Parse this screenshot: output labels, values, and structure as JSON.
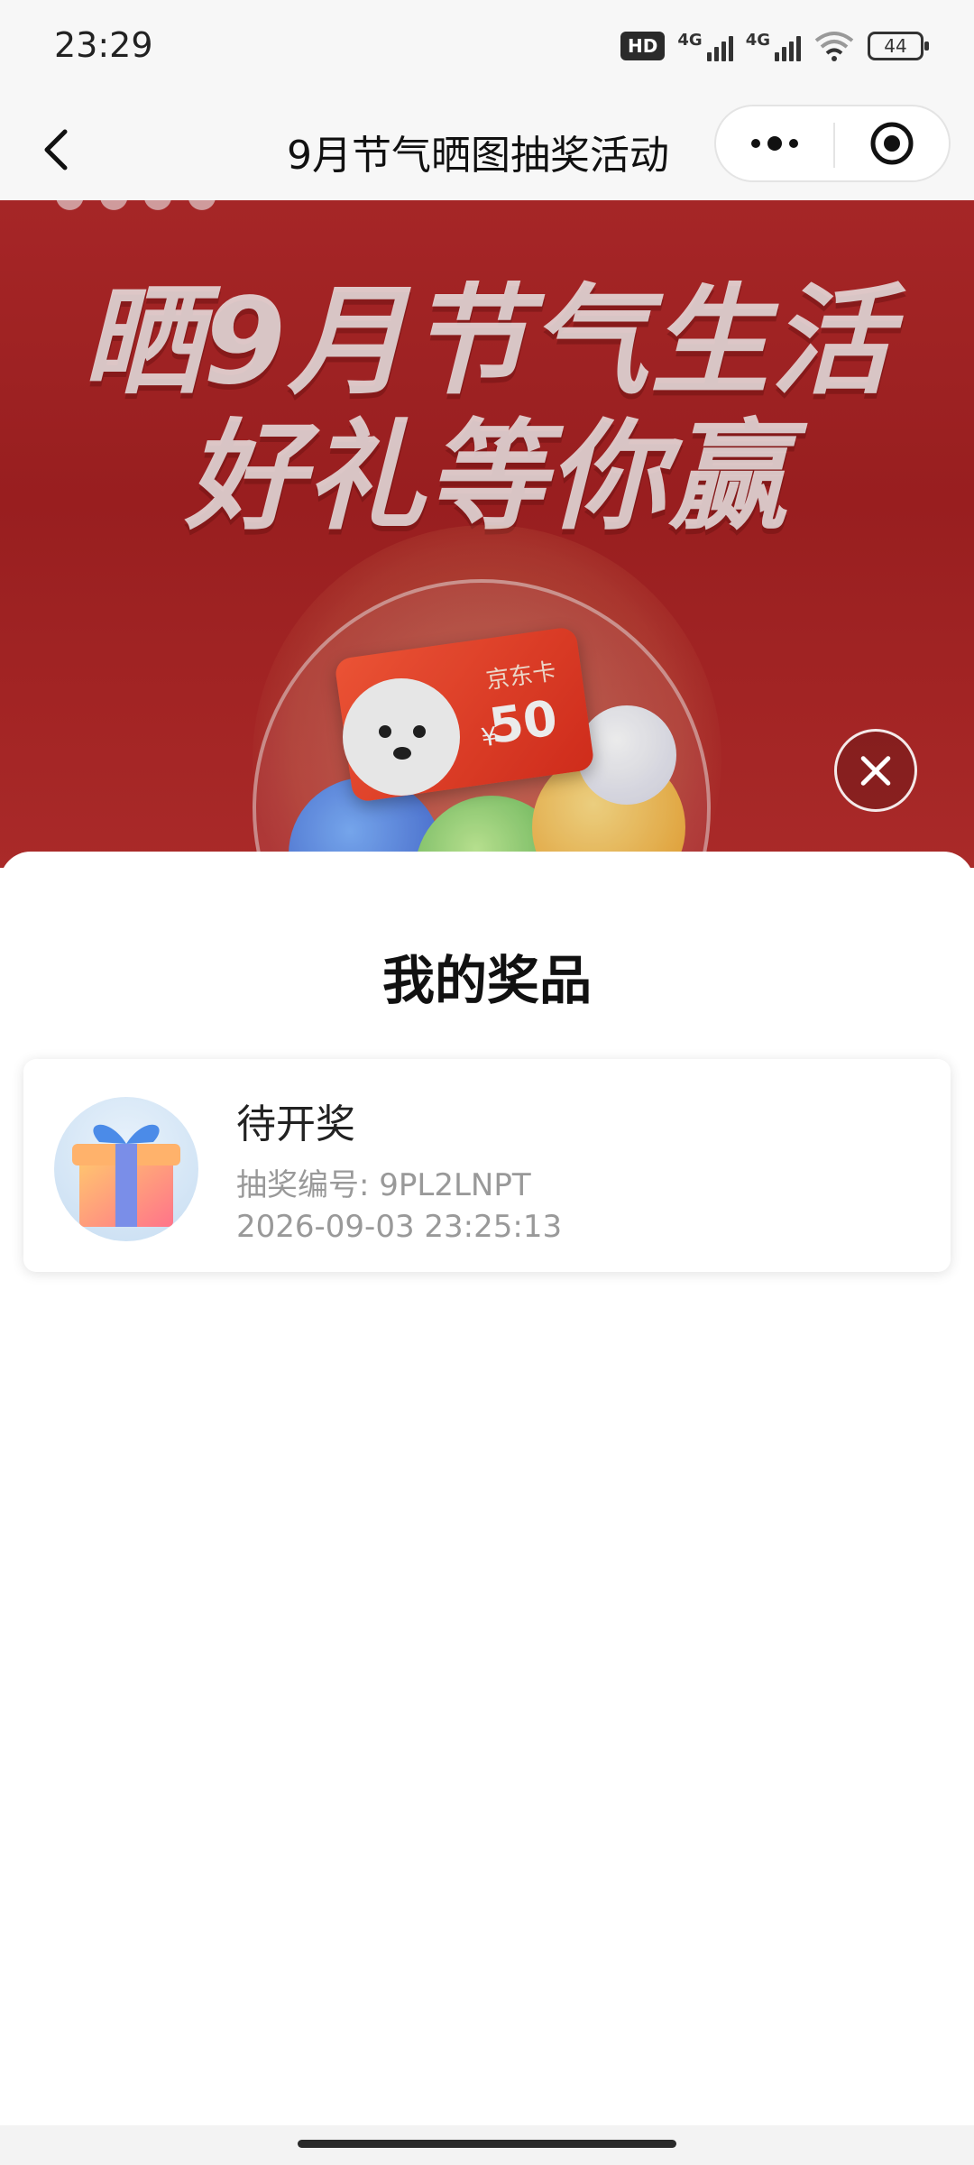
{
  "status_bar": {
    "time": "23:29",
    "hd_label": "HD",
    "network_1": "4G",
    "network_2": "4G",
    "battery": "44",
    "icons": [
      "hd-icon",
      "signal-icon",
      "signal-icon",
      "wifi-icon",
      "battery-icon"
    ]
  },
  "nav": {
    "title": "9月节气晒图抽奖活动",
    "back_icon": "chevron-left-icon",
    "more_icon": "more-dots-icon",
    "target_icon": "target-icon"
  },
  "banner": {
    "headline_line1": "晒9月节气生活",
    "headline_line2": "好礼等你赢",
    "card_name": "京东卡",
    "card_currency": "¥",
    "card_value": "50",
    "accent_color": "#b42a2b"
  },
  "sheet": {
    "title": "我的奖品",
    "prizes": [
      {
        "status": "待开奖",
        "draw_number_label": "抽奖编号: 9PL2LNPT",
        "timestamp": "2026-09-03 23:25:13",
        "icon": "gift-box-icon"
      }
    ]
  },
  "close_icon": "close-icon"
}
